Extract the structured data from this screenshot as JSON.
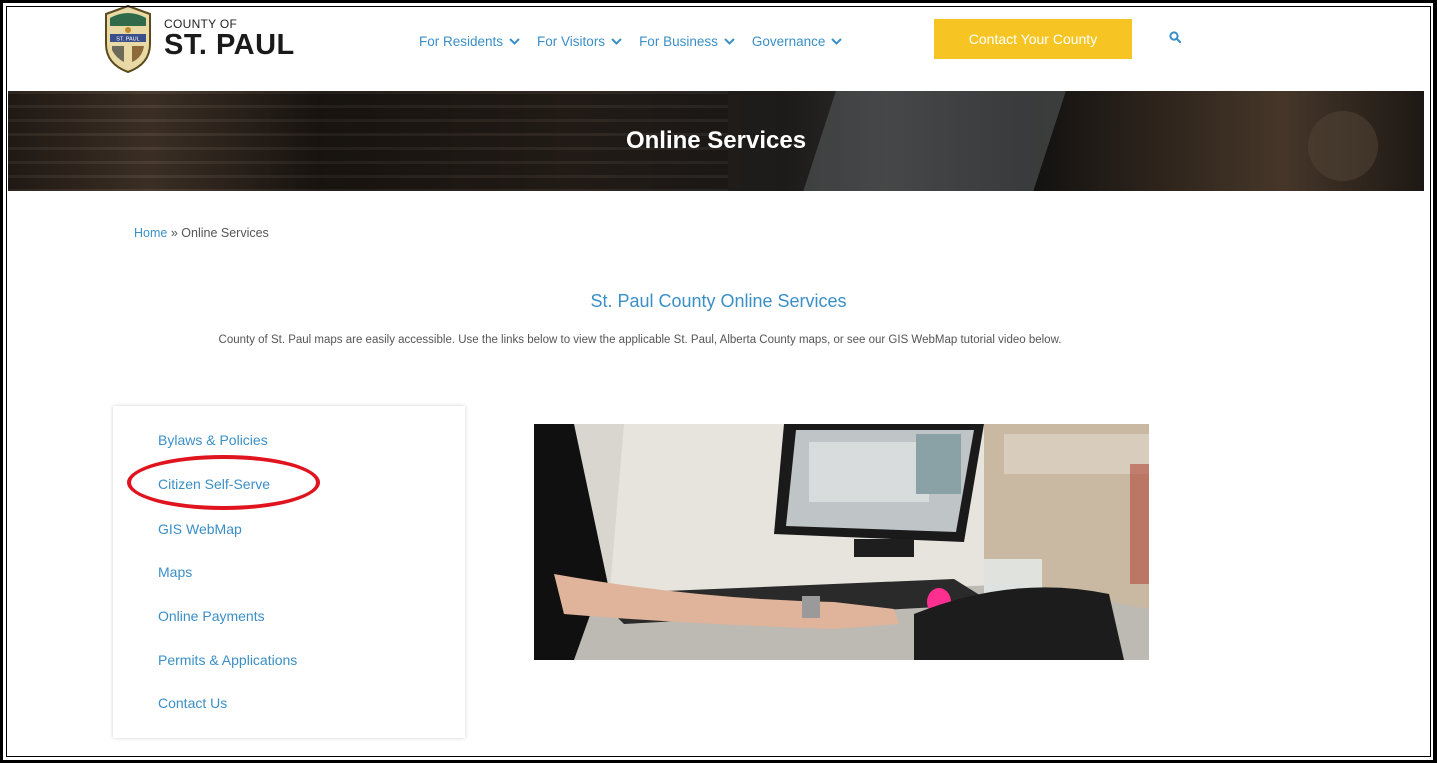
{
  "logo": {
    "small": "COUNTY OF",
    "big": "ST. PAUL",
    "seal_text": "ST. PAUL"
  },
  "nav": {
    "items": [
      {
        "label": "For Residents"
      },
      {
        "label": "For Visitors"
      },
      {
        "label": "For Business"
      },
      {
        "label": "Governance"
      }
    ],
    "contact_label": "Contact Your County",
    "search_icon": "search-icon"
  },
  "hero": {
    "title": "Online Services"
  },
  "breadcrumb": {
    "home": "Home",
    "separator": "»",
    "current": "Online Services"
  },
  "main": {
    "heading": "St. Paul County Online Services",
    "intro": "County of St. Paul maps are easily accessible. Use the links below to view the applicable St. Paul, Alberta County maps, or see our GIS WebMap tutorial video below."
  },
  "sidebar": {
    "links": [
      {
        "label": "Bylaws & Policies"
      },
      {
        "label": "Citizen Self-Serve"
      },
      {
        "label": "GIS WebMap"
      },
      {
        "label": "Maps"
      },
      {
        "label": "Online Payments"
      },
      {
        "label": "Permits & Applications"
      },
      {
        "label": "Contact Us"
      }
    ]
  },
  "colors": {
    "link": "#3a8fc7",
    "accent": "#f6c523",
    "highlight": "#e0141e"
  }
}
